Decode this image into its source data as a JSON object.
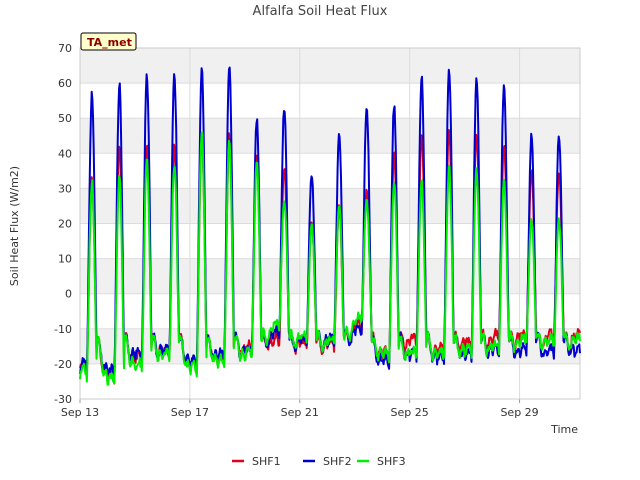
{
  "chart_data": {
    "type": "line",
    "title": "Alfalfa Soil Heat Flux",
    "xlabel": "Time",
    "ylabel": "Soil Heat Flux (W/m2)",
    "badge": "TA_met",
    "ylim": [
      -30,
      70
    ],
    "yticks": [
      -30,
      -20,
      -10,
      0,
      10,
      20,
      30,
      40,
      50,
      60,
      70
    ],
    "xlim_days": [
      13,
      31.2
    ],
    "xticks": [
      {
        "day": 13,
        "label": "Sep 13"
      },
      {
        "day": 17,
        "label": "Sep 17"
      },
      {
        "day": 21,
        "label": "Sep 21"
      },
      {
        "day": 25,
        "label": "Sep 25"
      },
      {
        "day": 29,
        "label": "Sep 29"
      }
    ],
    "grid": true,
    "legend_position": "bottom",
    "series": [
      {
        "name": "SHF1",
        "color": "#e0001b",
        "daily_peaks": [
          33,
          42,
          43,
          42,
          45,
          45,
          40,
          36,
          21,
          25,
          30,
          40,
          45,
          47,
          45,
          43,
          35
        ],
        "daily_minima": [
          -22,
          -25,
          -20,
          -18,
          -22,
          -20,
          -17,
          -15,
          -16,
          -16,
          -11,
          -19,
          -15,
          -17,
          -16,
          -14,
          -14
        ]
      },
      {
        "name": "SHF2",
        "color": "#0000cc",
        "daily_peaks": [
          57,
          60,
          62,
          62,
          64,
          65,
          50,
          53,
          34,
          45,
          52,
          54,
          62,
          64,
          61,
          60,
          45
        ],
        "daily_minima": [
          -22,
          -24,
          -19,
          -18,
          -21,
          -19,
          -18,
          -13,
          -15,
          -15,
          -12,
          -21,
          -19,
          -20,
          -19,
          -18,
          -18
        ]
      },
      {
        "name": "SHF3",
        "color": "#00ee00",
        "daily_peaks": [
          32,
          34,
          38,
          37,
          46,
          44,
          37,
          27,
          20,
          26,
          27,
          32,
          32,
          36,
          35,
          32,
          21
        ],
        "daily_minima": [
          -24,
          -26,
          -22,
          -19,
          -23,
          -21,
          -19,
          -11,
          -14,
          -15,
          -9,
          -19,
          -19,
          -19,
          -18,
          -17,
          -15
        ]
      }
    ]
  }
}
